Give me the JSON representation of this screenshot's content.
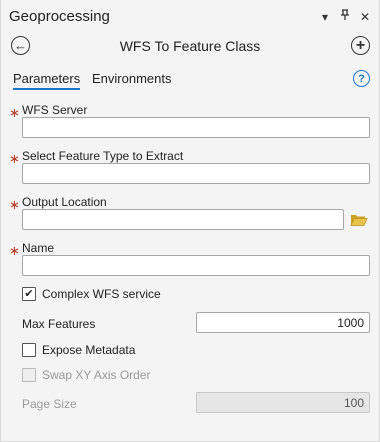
{
  "pane": {
    "title": "Geoprocessing",
    "controls": [
      "▾",
      "⊓",
      "✕"
    ]
  },
  "tool": {
    "title": "WFS To Feature Class",
    "back_icon": "←",
    "add_icon": "+"
  },
  "tabs": {
    "parameters": "Parameters",
    "environments": "Environments",
    "help_icon": "?"
  },
  "params": {
    "required_marker": "∗",
    "wfs_server": {
      "label": "WFS Server",
      "value": ""
    },
    "feature_type": {
      "label": "Select Feature Type to Extract",
      "value": ""
    },
    "output_location": {
      "label": "Output Location",
      "value": ""
    },
    "name": {
      "label": "Name",
      "value": ""
    },
    "complex_wfs": {
      "label": "Complex WFS service",
      "checked": "✔"
    },
    "max_features": {
      "label": "Max Features",
      "value": "1000"
    },
    "expose_metadata": {
      "label": "Expose Metadata",
      "checked": ""
    },
    "swap_xy": {
      "label": "Swap XY Axis Order",
      "checked": ""
    },
    "page_size": {
      "label": "Page Size",
      "value": "100"
    }
  }
}
